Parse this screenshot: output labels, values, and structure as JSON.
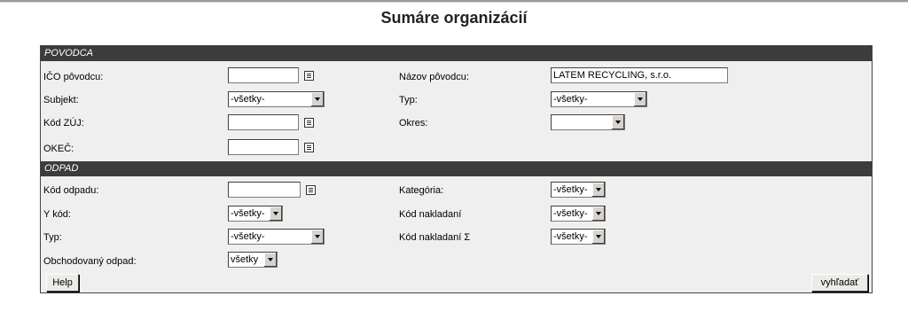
{
  "page": {
    "title": "Sumáre organizácií"
  },
  "sections": {
    "povodca": "POVODCA",
    "odpad": "ODPAD"
  },
  "povodca": {
    "ico_label": "IČO pôvodcu:",
    "ico_value": "",
    "nazov_label": "Názov pôvodcu:",
    "nazov_value": "LATEM RECYCLING, s.r.o.",
    "subjekt_label": "Subjekt:",
    "subjekt_value": "-všetky-",
    "typ_label": "Typ:",
    "typ_value": "-všetky-",
    "kodzuj_label": "Kód ZÚJ:",
    "kodzuj_value": "",
    "okres_label": "Okres:",
    "okres_value": "",
    "okec_label": "OKEČ:",
    "okec_value": ""
  },
  "odpad": {
    "kod_label": "Kód odpadu:",
    "kod_value": "",
    "kategoria_label": "Kategória:",
    "kategoria_value": "-všetky-",
    "ykod_label": "Y kód:",
    "ykod_value": "-všetky-",
    "nakladani_label": "Kód nakladaní",
    "nakladani_value": "-všetky-",
    "typ_label": "Typ:",
    "typ_value": "-všetky-",
    "nakladani_sum_label": "Kód nakladaní Σ",
    "nakladani_sum_value": "-všetky-",
    "obchod_label": "Obchodovaný odpad:",
    "obchod_value": "všetky"
  },
  "buttons": {
    "help": "Help",
    "search": "vyhľadať"
  }
}
